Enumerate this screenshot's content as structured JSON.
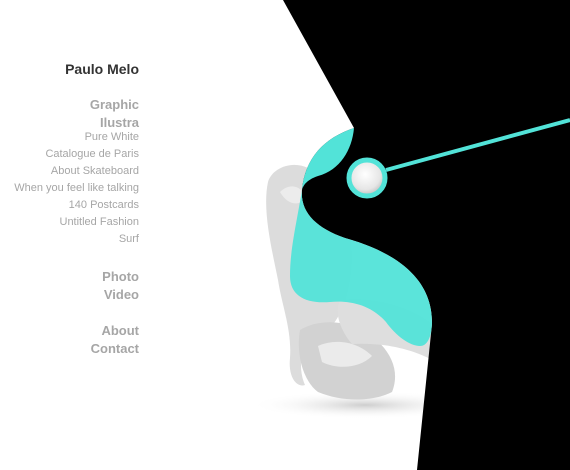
{
  "site": {
    "owner_name": "Paulo Melo"
  },
  "nav": {
    "graphic_label": "Graphic",
    "illustra_label": "Ilustra",
    "ilustra_items": [
      "Pure White",
      "Catalogue de Paris",
      "About Skateboard",
      "When you feel like talking",
      "140 Postcards",
      "Untitled Fashion",
      "Surf"
    ],
    "photo_label": "Photo",
    "video_label": "Video",
    "about_label": "About",
    "contact_label": "Contact"
  },
  "colors": {
    "accent": "#52e3d8",
    "background": "#ffffff",
    "dark": "#000000",
    "text_primary": "#333333",
    "text_muted": "#a6a6a6"
  }
}
